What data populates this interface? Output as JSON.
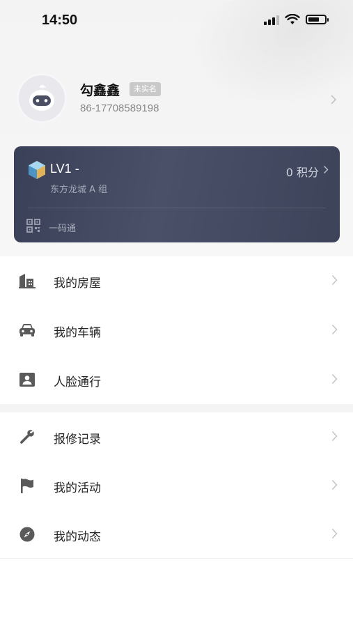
{
  "status_bar": {
    "time": "14:50",
    "battery_level": 0.7
  },
  "profile": {
    "name": "勾鑫鑫",
    "verify_badge": "未实名",
    "phone": "86-17708589198"
  },
  "member_card": {
    "level": "LV1 -",
    "community": "东方龙城 A 组",
    "points": "0 积分",
    "qr_label": "一码通"
  },
  "menu_group_1": [
    {
      "label": "我的房屋",
      "icon": "building-icon"
    },
    {
      "label": "我的车辆",
      "icon": "car-icon"
    },
    {
      "label": "人脸通行",
      "icon": "face-id-icon"
    }
  ],
  "menu_group_2": [
    {
      "label": "报修记录",
      "icon": "wrench-icon"
    },
    {
      "label": "我的活动",
      "icon": "flag-icon"
    },
    {
      "label": "我的动态",
      "icon": "compass-icon"
    }
  ],
  "colors": {
    "card_bg": "#43495f",
    "icon_gray": "#5a5a5a",
    "chevron": "#c4c4c4"
  }
}
